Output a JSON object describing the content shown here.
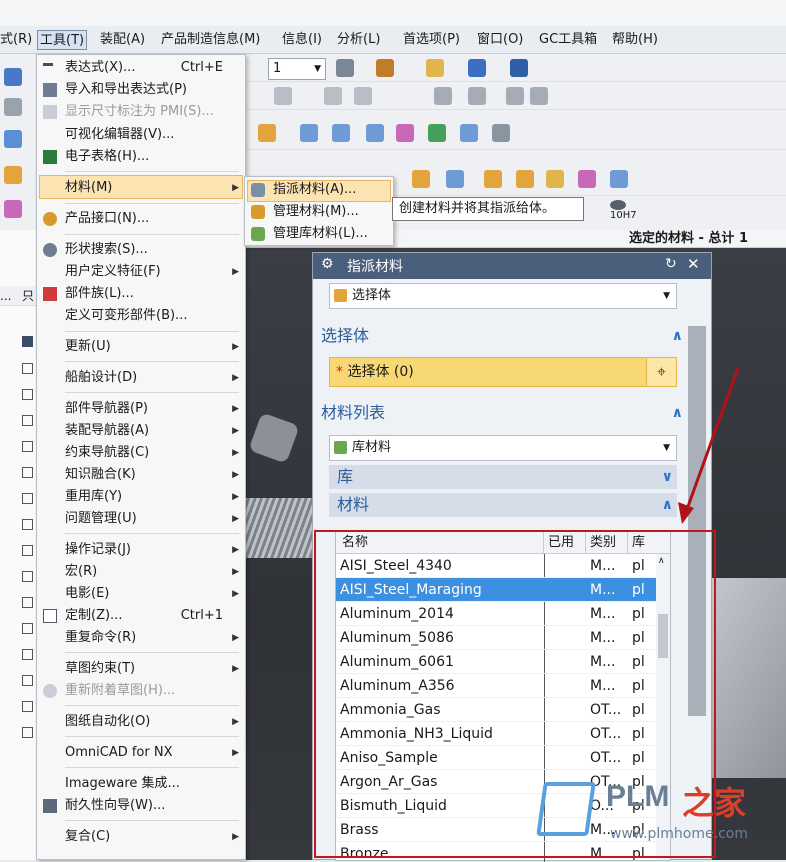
{
  "menubar": {
    "items": [
      "式(R)",
      "工具(T)",
      "装配(A)",
      "产品制造信息(M)",
      "信息(I)",
      "分析(L)",
      "首选项(P)",
      "窗口(O)",
      "GC工具箱",
      "帮助(H)"
    ]
  },
  "toolbar": {
    "combo_value": "1",
    "dimension_label": "10H7",
    "selected_status": "选定的材料 - 总计 1"
  },
  "left_panel": {
    "col1": "...",
    "col2": "只"
  },
  "tools_menu": {
    "items": [
      {
        "label": "表达式(X)...",
        "shortcut": "Ctrl+E"
      },
      {
        "label": "导入和导出表达式(P)"
      },
      {
        "label": "显示尺寸标注为 PMI(S)..."
      },
      {
        "label": "可视化编辑器(V)..."
      },
      {
        "label": "电子表格(H)..."
      },
      {
        "label": "材料(M)"
      },
      {
        "label": "产品接口(N)..."
      },
      {
        "label": "形状搜索(S)..."
      },
      {
        "label": "用户定义特征(F)"
      },
      {
        "label": "部件族(L)..."
      },
      {
        "label": "定义可变形部件(B)..."
      },
      {
        "label": "更新(U)"
      },
      {
        "label": "船舶设计(D)"
      },
      {
        "label": "部件导航器(P)"
      },
      {
        "label": "装配导航器(A)"
      },
      {
        "label": "约束导航器(C)"
      },
      {
        "label": "知识融合(K)"
      },
      {
        "label": "重用库(Y)"
      },
      {
        "label": "问题管理(U)"
      },
      {
        "label": "操作记录(J)"
      },
      {
        "label": "宏(R)"
      },
      {
        "label": "电影(E)"
      },
      {
        "label": "定制(Z)...",
        "shortcut": "Ctrl+1"
      },
      {
        "label": "重复命令(R)"
      },
      {
        "label": "草图约束(T)"
      },
      {
        "label": "重新附着草图(H)..."
      },
      {
        "label": "图纸自动化(O)"
      },
      {
        "label": "OmniCAD for NX"
      },
      {
        "label": "Imageware 集成..."
      },
      {
        "label": "耐久性向导(W)..."
      },
      {
        "label": "复合(C)"
      }
    ]
  },
  "material_submenu": {
    "items": [
      "指派材料(A)...",
      "管理材料(M)...",
      "管理库材料(L)..."
    ]
  },
  "tooltip": "创建材料并将其指派给体。",
  "dialog": {
    "title": "指派材料",
    "type_combo": "选择体",
    "select_section": "选择体",
    "select_body": "选择体 (0)",
    "material_list_section": "材料列表",
    "list_combo": "库材料",
    "library_section": "库",
    "materials_section": "材料",
    "columns": [
      "名称",
      "已用",
      "类别",
      "库"
    ],
    "rows": [
      [
        "AISI_Steel_4340",
        "",
        "M...",
        "pl"
      ],
      [
        "AISI_Steel_Maraging",
        "",
        "M...",
        "pl"
      ],
      [
        "Aluminum_2014",
        "",
        "M...",
        "pl"
      ],
      [
        "Aluminum_5086",
        "",
        "M...",
        "pl"
      ],
      [
        "Aluminum_6061",
        "",
        "M...",
        "pl"
      ],
      [
        "Aluminum_A356",
        "",
        "M...",
        "pl"
      ],
      [
        "Ammonia_Gas",
        "",
        "OT...",
        "pl"
      ],
      [
        "Ammonia_NH3_Liquid",
        "",
        "OT...",
        "pl"
      ],
      [
        "Aniso_Sample",
        "",
        "OT...",
        "pl"
      ],
      [
        "Argon_Ar_Gas",
        "",
        "OT...",
        "pl"
      ],
      [
        "Bismuth_Liquid",
        "",
        "O...",
        "pl"
      ],
      [
        "Brass",
        "",
        "M...",
        "pl"
      ],
      [
        "Bronze",
        "",
        "M...",
        "pl"
      ]
    ]
  },
  "watermark": {
    "brand": "PLM",
    "brand_cn": "之家",
    "url": "www.plmhome.com"
  },
  "colors": {
    "accent": "#3d8fe0",
    "highlight": "#fbe3b2",
    "required": "#f7d873",
    "annotation": "#c0191d"
  }
}
